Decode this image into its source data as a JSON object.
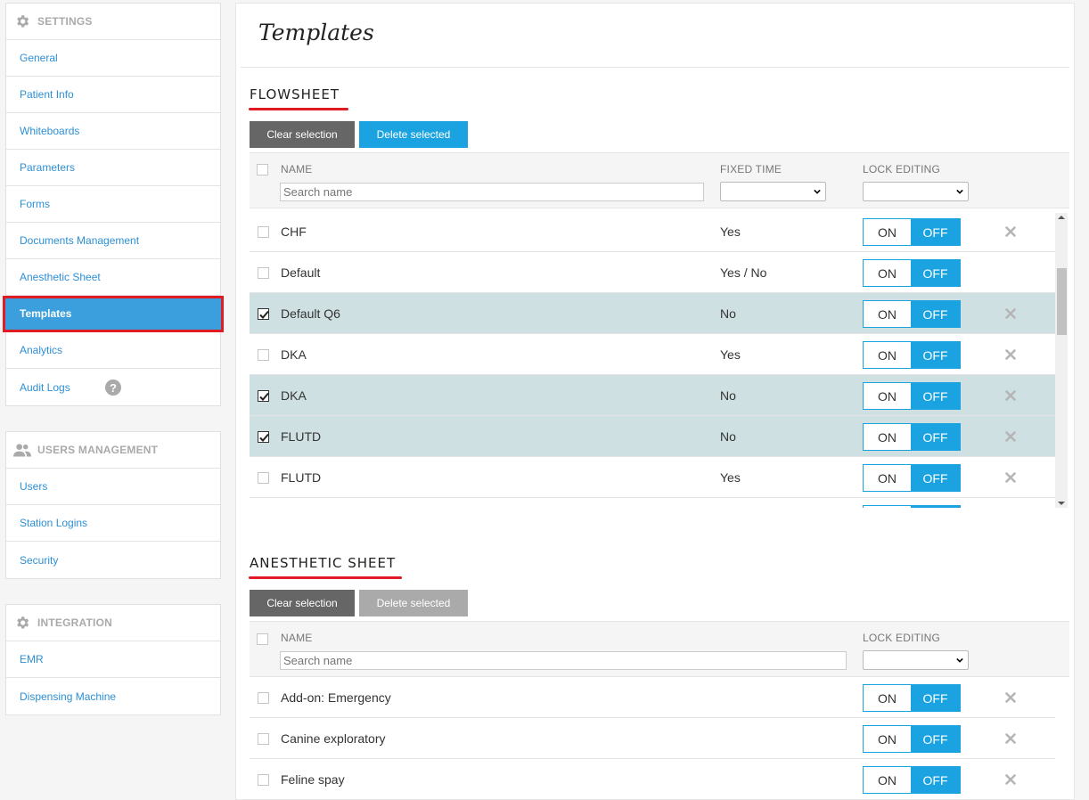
{
  "colors": {
    "accent": "#1aa3e0",
    "active_nav": "#3a9fdc",
    "highlight_red": "#e01b24",
    "selected_row": "#cfe0e3",
    "link": "#2d8fd5"
  },
  "sidebar": {
    "settings": {
      "title": "SETTINGS",
      "icon": "gear-icon",
      "items": [
        {
          "label": "General"
        },
        {
          "label": "Patient Info"
        },
        {
          "label": "Whiteboards"
        },
        {
          "label": "Parameters"
        },
        {
          "label": "Forms"
        },
        {
          "label": "Documents Management"
        },
        {
          "label": "Anesthetic Sheet"
        },
        {
          "label": "Templates",
          "active": true
        },
        {
          "label": "Analytics"
        },
        {
          "label": "Audit Logs",
          "help": "?"
        }
      ]
    },
    "users": {
      "title": "USERS MANAGEMENT",
      "icon": "users-icon",
      "items": [
        {
          "label": "Users"
        },
        {
          "label": "Station Logins"
        },
        {
          "label": "Security"
        }
      ]
    },
    "integration": {
      "title": "INTEGRATION",
      "icon": "gear-icon",
      "items": [
        {
          "label": "EMR"
        },
        {
          "label": "Dispensing Machine"
        }
      ]
    }
  },
  "main": {
    "title": "Templates",
    "flowsheet": {
      "title": "FLOWSHEET",
      "clear_label": "Clear selection",
      "delete_label": "Delete selected",
      "columns": {
        "name": "NAME",
        "fixed_time": "FIXED TIME",
        "lock_editing": "LOCK EDITING"
      },
      "search_placeholder": "Search name",
      "rows": [
        {
          "name": "CHF",
          "fixed_time": "Yes",
          "checked": false,
          "deletable": true
        },
        {
          "name": "Default",
          "fixed_time": "Yes / No",
          "checked": false,
          "deletable": false
        },
        {
          "name": "Default Q6",
          "fixed_time": "No",
          "checked": true,
          "deletable": true
        },
        {
          "name": "DKA",
          "fixed_time": "Yes",
          "checked": false,
          "deletable": true
        },
        {
          "name": "DKA",
          "fixed_time": "No",
          "checked": true,
          "deletable": true
        },
        {
          "name": "FLUTD",
          "fixed_time": "No",
          "checked": true,
          "deletable": true
        },
        {
          "name": "FLUTD",
          "fixed_time": "Yes",
          "checked": false,
          "deletable": true
        }
      ]
    },
    "anesthetic": {
      "title": "ANESTHETIC SHEET",
      "clear_label": "Clear selection",
      "delete_label": "Delete selected",
      "columns": {
        "name": "NAME",
        "lock_editing": "LOCK EDITING"
      },
      "search_placeholder": "Search name",
      "rows": [
        {
          "name": "Add-on: Emergency",
          "checked": false
        },
        {
          "name": "Canine exploratory",
          "checked": false
        },
        {
          "name": "Feline spay",
          "checked": false
        }
      ]
    },
    "toggle": {
      "on_label": "ON",
      "off_label": "OFF"
    }
  }
}
